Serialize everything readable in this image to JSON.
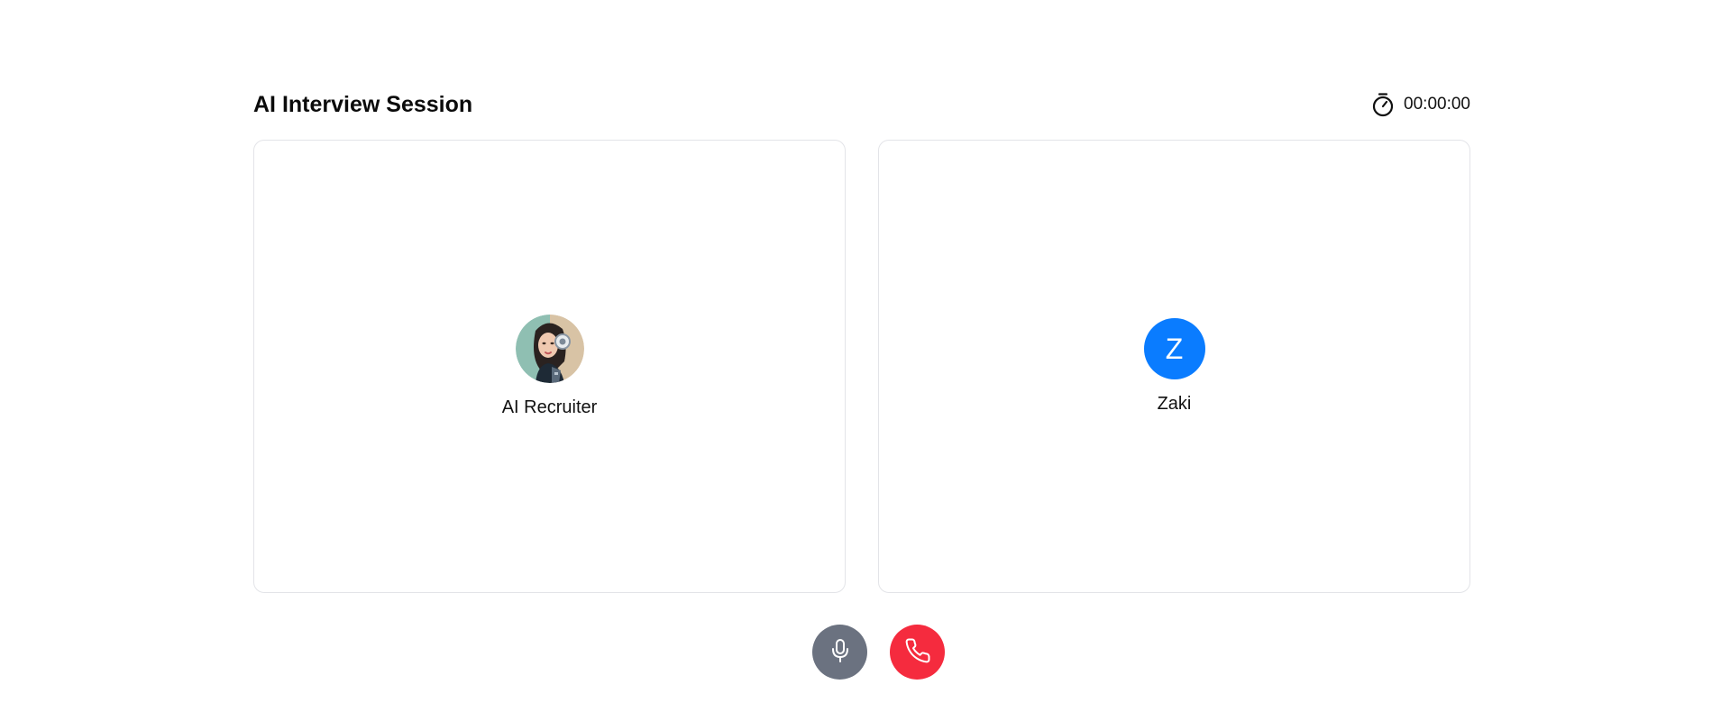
{
  "header": {
    "title": "AI Interview Session",
    "timer": "00:00:00",
    "timer_icon": "stopwatch-icon"
  },
  "participants": [
    {
      "name": "AI Recruiter",
      "avatar_type": "image",
      "avatar_icon": "ai-recruiter-avatar"
    },
    {
      "name": "Zaki",
      "avatar_type": "initial",
      "initial": "Z",
      "avatar_color": "#0a7cff"
    }
  ],
  "controls": {
    "mic_icon": "microphone-icon",
    "mic_color": "#6b7280",
    "hangup_icon": "phone-hangup-icon",
    "hangup_color": "#f52b3e"
  }
}
